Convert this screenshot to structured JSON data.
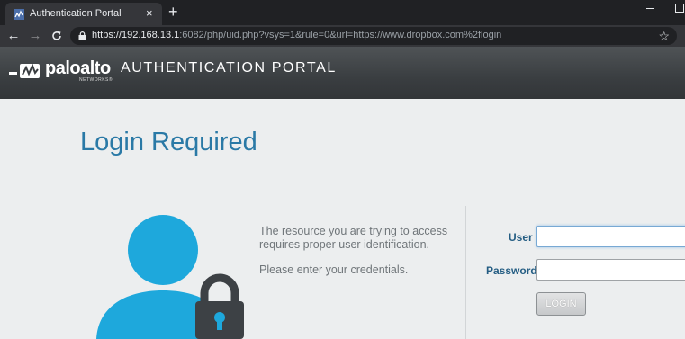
{
  "browser": {
    "tab_title": "Authentication Portal",
    "tab_close": "×",
    "new_tab": "+",
    "url_host": "https://192.168.13.1",
    "url_rest": ":6082/php/uid.php?vsys=1&rule=0&url=https://www.dropbox.com%2flogin",
    "back": "←",
    "forward": "→",
    "reload": "C",
    "star": "☆"
  },
  "header": {
    "brand_name": "paloalto",
    "brand_sub": "NETWORKS®",
    "portal_title": "AUTHENTICATION PORTAL"
  },
  "main": {
    "title": "Login Required",
    "message_line1": "The resource you are trying to access requires proper user identification.",
    "message_line2": "Please enter your credentials."
  },
  "form": {
    "user_label": "User",
    "password_label": "Password",
    "user_value": "",
    "password_value": "",
    "login_label": "LOGIN"
  },
  "colors": {
    "accent": "#2a79a6",
    "label": "#245d83",
    "avatar": "#1ea8dc",
    "lock": "#3d4145"
  }
}
